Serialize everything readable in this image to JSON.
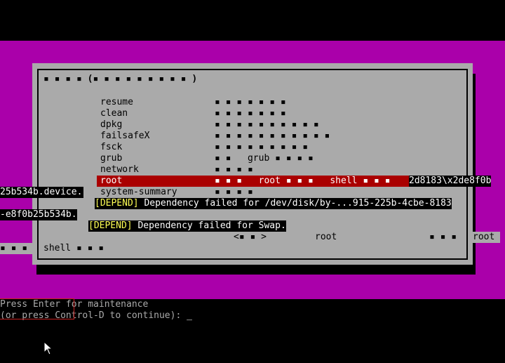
{
  "colors": {
    "band": "#aa00aa",
    "dialog": "#aaaaaa",
    "selected_row": "#aa0000",
    "depend_tag": "#ffff55",
    "terminal_text": "#aaaaaa"
  },
  "dialog": {
    "title": "▪ ▪ ▪ ▪ (▪ ▪ ▪ ▪ ▪ ▪ ▪ ▪ ▪ )",
    "items": [
      {
        "name": "resume",
        "desc": "▪ ▪ ▪ ▪ ▪ ▪ ▪"
      },
      {
        "name": "clean",
        "desc": "▪ ▪ ▪ ▪ ▪ ▪ ▪"
      },
      {
        "name": "dpkg",
        "desc": "▪ ▪ ▪ ▪ ▪ ▪ ▪ ▪ ▪ ▪"
      },
      {
        "name": "failsafeX",
        "desc": "▪ ▪ ▪ ▪ ▪ ▪ ▪ ▪ ▪ ▪ ▪"
      },
      {
        "name": "fsck",
        "desc": "▪ ▪ ▪ ▪ ▪ ▪ ▪ ▪ ▪"
      },
      {
        "name": "grub",
        "desc": "▪ ▪   grub ▪ ▪ ▪ ▪"
      },
      {
        "name": "network",
        "desc": "▪ ▪ ▪ ▪"
      },
      {
        "name": "root",
        "desc": "▪ ▪ ▪   root ▪ ▪ ▪   shell ▪ ▪ ▪"
      },
      {
        "name": "system-summary",
        "desc": "▪ ▪ ▪ ▪"
      }
    ],
    "ok_button": "<▪ ▪ >",
    "root_label": "root",
    "bottom_dots": "▪ ▪ ▪",
    "root_right": "root",
    "left_dots": "▪ ▪ ▪",
    "shell_text": "shell ▪ ▪ ▪"
  },
  "overlay": {
    "right_fragment": "2d8183\\x2de8f0b",
    "left_device": "25b534b.device.",
    "left_fragment": "-e8f0b25b534b.",
    "depend_tag": "[DEPEND]",
    "msg1": " Dependency failed for /dev/disk/by-...915-225b-4cbe-8183",
    "msg2": " Dependency failed for Swap."
  },
  "terminal": {
    "press_enter": "Press Enter",
    "for_maintenance": " for maintenance",
    "control_d": "(or press Control-D to continue): ",
    "cursor": "_"
  }
}
